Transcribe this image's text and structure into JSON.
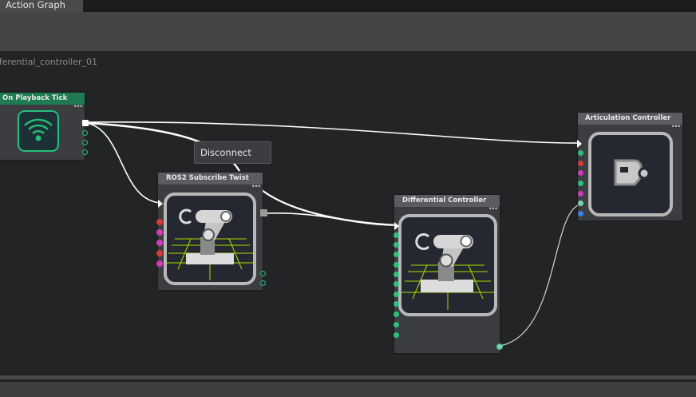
{
  "window": {
    "tab_label": "Action Graph",
    "graph_path": "fferential_controller_01"
  },
  "nodes": {
    "on_playback_tick": {
      "title": "On Playback Tick",
      "menu": "•••",
      "icon": "wifi-tick-icon"
    },
    "ros2_subscribe_twist": {
      "title": "ROS2 Subscribe Twist",
      "menu": "•••",
      "icon": "robot-arm-icon"
    },
    "differential_controller": {
      "title": "Differential Controller",
      "menu": "•••",
      "icon": "robot-arm-icon"
    },
    "articulation_controller": {
      "title": "Articulation Controller",
      "menu": "•••",
      "icon": "articulation-plug-icon"
    }
  },
  "context_menu": {
    "items": [
      {
        "label": "Disconnect"
      }
    ]
  },
  "colors": {
    "background": "#232426",
    "node_header": "#5a5c62",
    "event_header": "#1f7c52",
    "exec_port": "#2fbf7d",
    "wire": "#ffffff",
    "icon_green": "#22c07a",
    "grid_yellow": "#a8e000",
    "port_red": "#d83a3a",
    "port_magenta": "#d13ab8",
    "port_blue": "#3a7ee8"
  }
}
